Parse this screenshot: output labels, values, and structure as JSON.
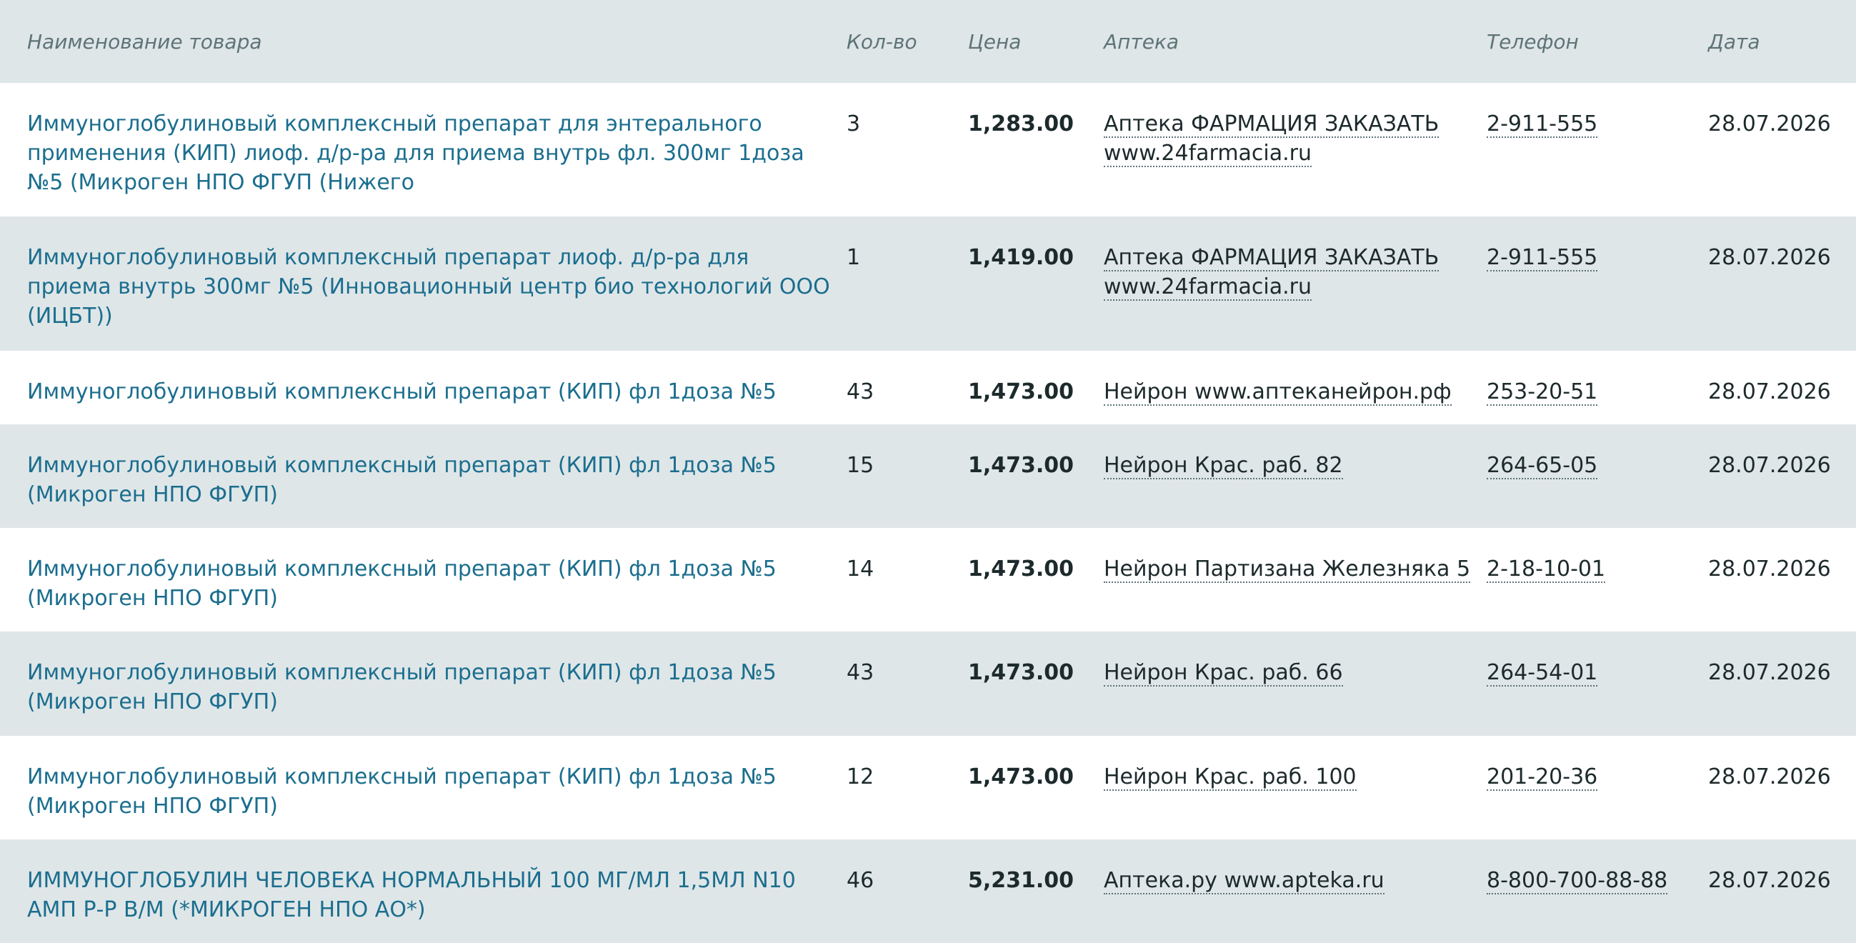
{
  "table": {
    "columns": {
      "name": "Наименование товара",
      "qty": "Кол-во",
      "price": "Цена",
      "pharmacy": "Аптека",
      "phone": "Телефон",
      "date": "Дата"
    },
    "rows": [
      {
        "name": "Иммуноглобулиновый комплексный препарат для энтерального применения (КИП) лиоф. д/р-ра для приема внутрь фл. 300мг 1доза №5 (Микроген НПО ФГУП (Нижего",
        "qty": "3",
        "price": "1,283.00",
        "pharmacy_name": "Аптека ФАРМАЦИЯ ЗАКАЗАТЬ",
        "pharmacy_site": "www.24farmacia.ru",
        "phone": "2-911-555",
        "date": "28.07.2026"
      },
      {
        "name": "Иммуноглобулиновый комплексный препарат лиоф. д/р-ра для приема внутрь 300мг №5 (Инновационный центр био технологий ООО (ИЦБТ))",
        "qty": "1",
        "price": "1,419.00",
        "pharmacy_name": "Аптека ФАРМАЦИЯ ЗАКАЗАТЬ",
        "pharmacy_site": "www.24farmacia.ru",
        "phone": "2-911-555",
        "date": "28.07.2026"
      },
      {
        "name": "Иммуноглобулиновый комплексный препарат (КИП) фл 1доза №5",
        "qty": "43",
        "price": "1,473.00",
        "pharmacy_name": "Нейрон www.аптеканейрон.рф",
        "pharmacy_site": "",
        "phone": "253-20-51",
        "date": "28.07.2026"
      },
      {
        "name": "Иммуноглобулиновый комплексный препарат (КИП) фл 1доза №5 (Микроген НПО ФГУП)",
        "qty": "15",
        "price": "1,473.00",
        "pharmacy_name": "Нейрон Крас. раб. 82",
        "pharmacy_site": "",
        "phone": "264-65-05",
        "date": "28.07.2026"
      },
      {
        "name": "Иммуноглобулиновый комплексный препарат (КИП) фл 1доза №5 (Микроген НПО ФГУП)",
        "qty": "14",
        "price": "1,473.00",
        "pharmacy_name": "Нейрон Партизана Железняка 5",
        "pharmacy_site": "",
        "phone": "2-18-10-01",
        "date": "28.07.2026"
      },
      {
        "name": "Иммуноглобулиновый комплексный препарат (КИП) фл 1доза №5 (Микроген НПО ФГУП)",
        "qty": "43",
        "price": "1,473.00",
        "pharmacy_name": "Нейрон Крас. раб. 66",
        "pharmacy_site": "",
        "phone": "264-54-01",
        "date": "28.07.2026"
      },
      {
        "name": "Иммуноглобулиновый комплексный препарат (КИП) фл 1доза №5 (Микроген НПО ФГУП)",
        "qty": "12",
        "price": "1,473.00",
        "pharmacy_name": "Нейрон Крас. раб. 100",
        "pharmacy_site": "",
        "phone": "201-20-36",
        "date": "28.07.2026"
      },
      {
        "name": "ИММУНОГЛОБУЛИН ЧЕЛОВЕКА НОРМАЛЬНЫЙ 100 МГ/МЛ 1,5МЛ N10 АМП Р-Р В/М (*МИКРОГЕН НПО АО*)",
        "qty": "46",
        "price": "5,231.00",
        "pharmacy_name": "Аптека.ру www.apteka.ru",
        "pharmacy_site": "",
        "phone": "8-800-700-88-88",
        "date": "28.07.2026"
      }
    ]
  },
  "colors": {
    "header_bg": "#dfe6e8",
    "header_text": "#5e7477",
    "row_alt_bg": "#dfe6e8",
    "link_text": "#1b6e8e",
    "body_text": "#1d2a2c"
  }
}
